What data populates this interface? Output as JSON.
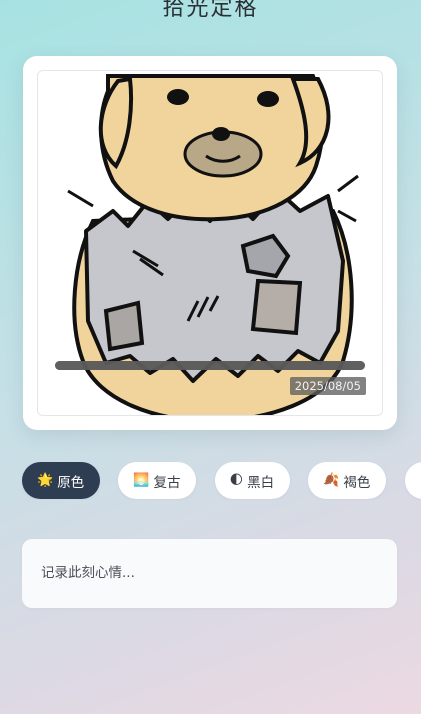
{
  "header": {
    "title": "拾光定格"
  },
  "photo": {
    "date_stamp": "2025/08/05",
    "progress": 1.0
  },
  "filters": [
    {
      "emoji": "🌟",
      "label": "原色",
      "active": true
    },
    {
      "emoji": "🌅",
      "label": "复古",
      "active": false
    },
    {
      "emoji": "🌓",
      "label": "黑白",
      "active": false
    },
    {
      "emoji": "🍂",
      "label": "褐色",
      "active": false
    },
    {
      "emoji": "✨",
      "label": "",
      "active": false
    }
  ],
  "note": {
    "placeholder": "记录此刻心情..."
  }
}
